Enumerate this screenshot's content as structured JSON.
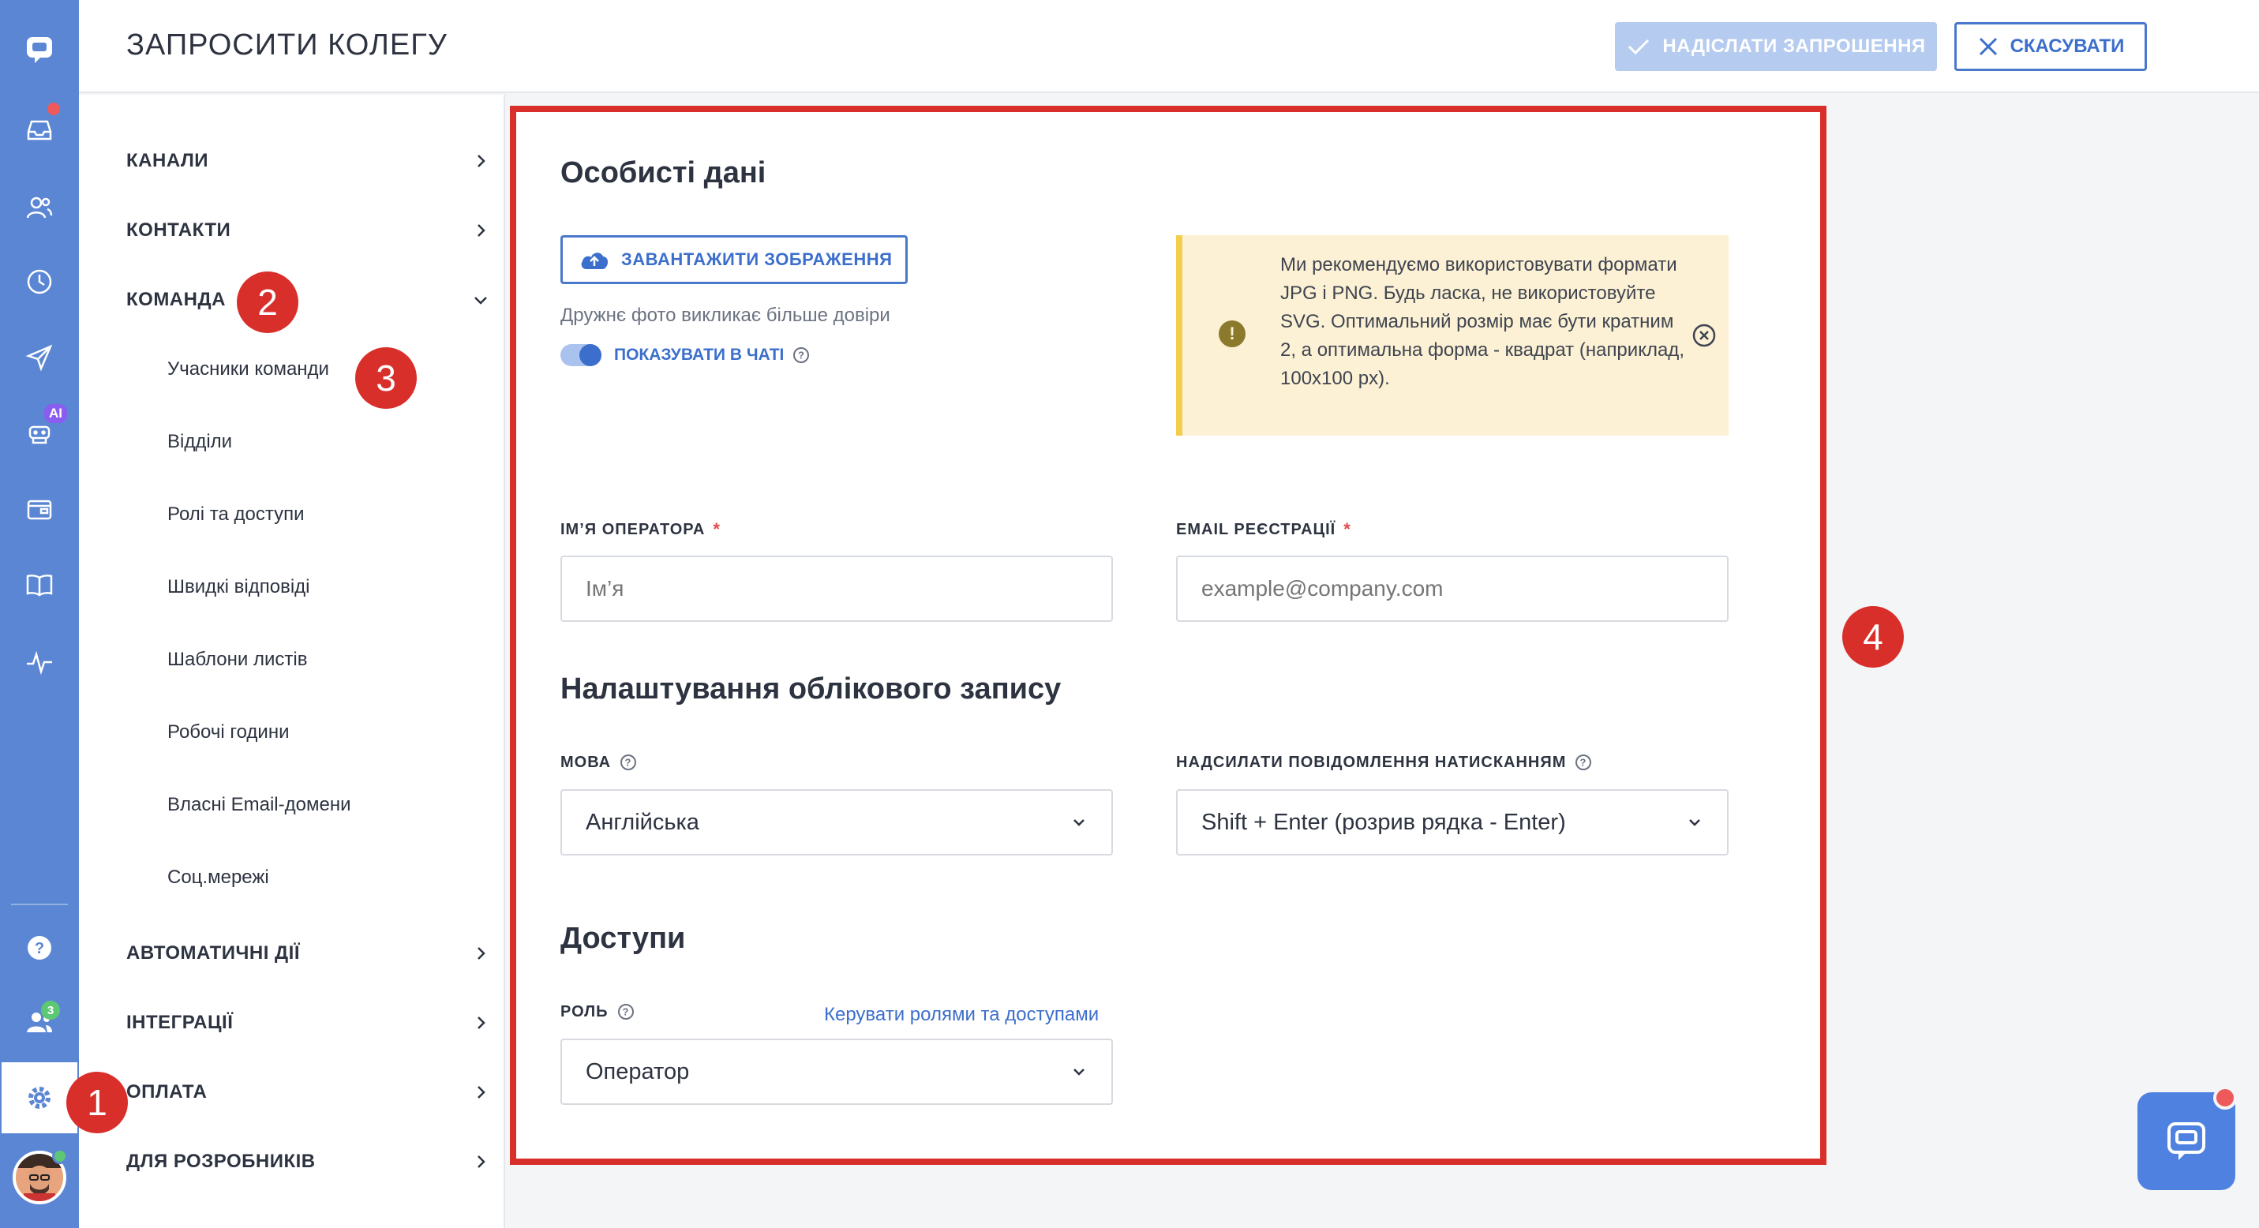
{
  "header": {
    "title": "ЗАПРОСИТИ КОЛЕГУ",
    "send_label": "НАДІСЛАТИ ЗАПРОШЕННЯ",
    "cancel_label": "СКАСУВАТИ"
  },
  "rail": {
    "icons": [
      "chat-logo-icon",
      "inbox-icon",
      "contacts-icon",
      "history-icon",
      "send-icon",
      "ai-bot-icon",
      "wallet-icon",
      "book-icon",
      "pulse-icon",
      "help-icon",
      "team-icon",
      "gear-icon",
      "avatar"
    ],
    "ai_badge": "AI",
    "team_badge": "3"
  },
  "menu": {
    "channels": "КАНАЛИ",
    "contacts": "КОНТАКТИ",
    "team": "КОМАНДА",
    "team_sub": [
      "Учасники команди",
      "Відділи",
      "Ролі та доступи",
      "Швидкі відповіді",
      "Шаблони листів",
      "Робочі години",
      "Власні Email-домени",
      "Соц.мережі"
    ],
    "automation": "АВТОМАТИЧНІ ДІЇ",
    "integrations": "ІНТЕГРАЦІЇ",
    "billing": "ОПЛАТА",
    "developers": "ДЛЯ РОЗРОБНИКІВ"
  },
  "markers": [
    "1",
    "2",
    "3",
    "4"
  ],
  "form": {
    "personal_title": "Особисті дані",
    "upload_label": "ЗАВАНТАЖИТИ ЗОБРАЖЕННЯ",
    "upload_hint": "Дружнє фото викликає більше довіри",
    "show_in_chat_label": "ПОКАЗУВАТИ В ЧАТІ",
    "show_in_chat_on": true,
    "warning_text": "Ми рекомендуємо використовувати формати JPG і PNG. Будь ласка, не використовуйте SVG. Оптимальний розмір має бути кратним 2, а оптимальна форма - квадрат (наприклад, 100x100 px).",
    "operator_name_label": "ІМ’Я ОПЕРАТОРА",
    "operator_name_placeholder": "Ім’я",
    "email_label": "EMAIL РЕЄСТРАЦІЇ",
    "email_placeholder": "example@company.com",
    "required_mark": "*",
    "account_title": "Налаштування облікового запису",
    "language_label": "МОВА",
    "language_value": "Англійська",
    "send_key_label": "НАДСИЛАТИ ПОВІДОМЛЕННЯ НАТИСКАННЯМ",
    "send_key_value": "Shift + Enter (розрив рядка - Enter)",
    "access_title": "Доступи",
    "role_label": "РОЛЬ",
    "manage_roles_link": "Керувати ролями та доступами",
    "role_value": "Оператор"
  },
  "colors": {
    "rail": "#5b86d4",
    "accent": "#3c6fcb",
    "marker": "#d92f2a",
    "warning_bg": "#fcf1d4",
    "warning_border": "#f5cd4d"
  }
}
